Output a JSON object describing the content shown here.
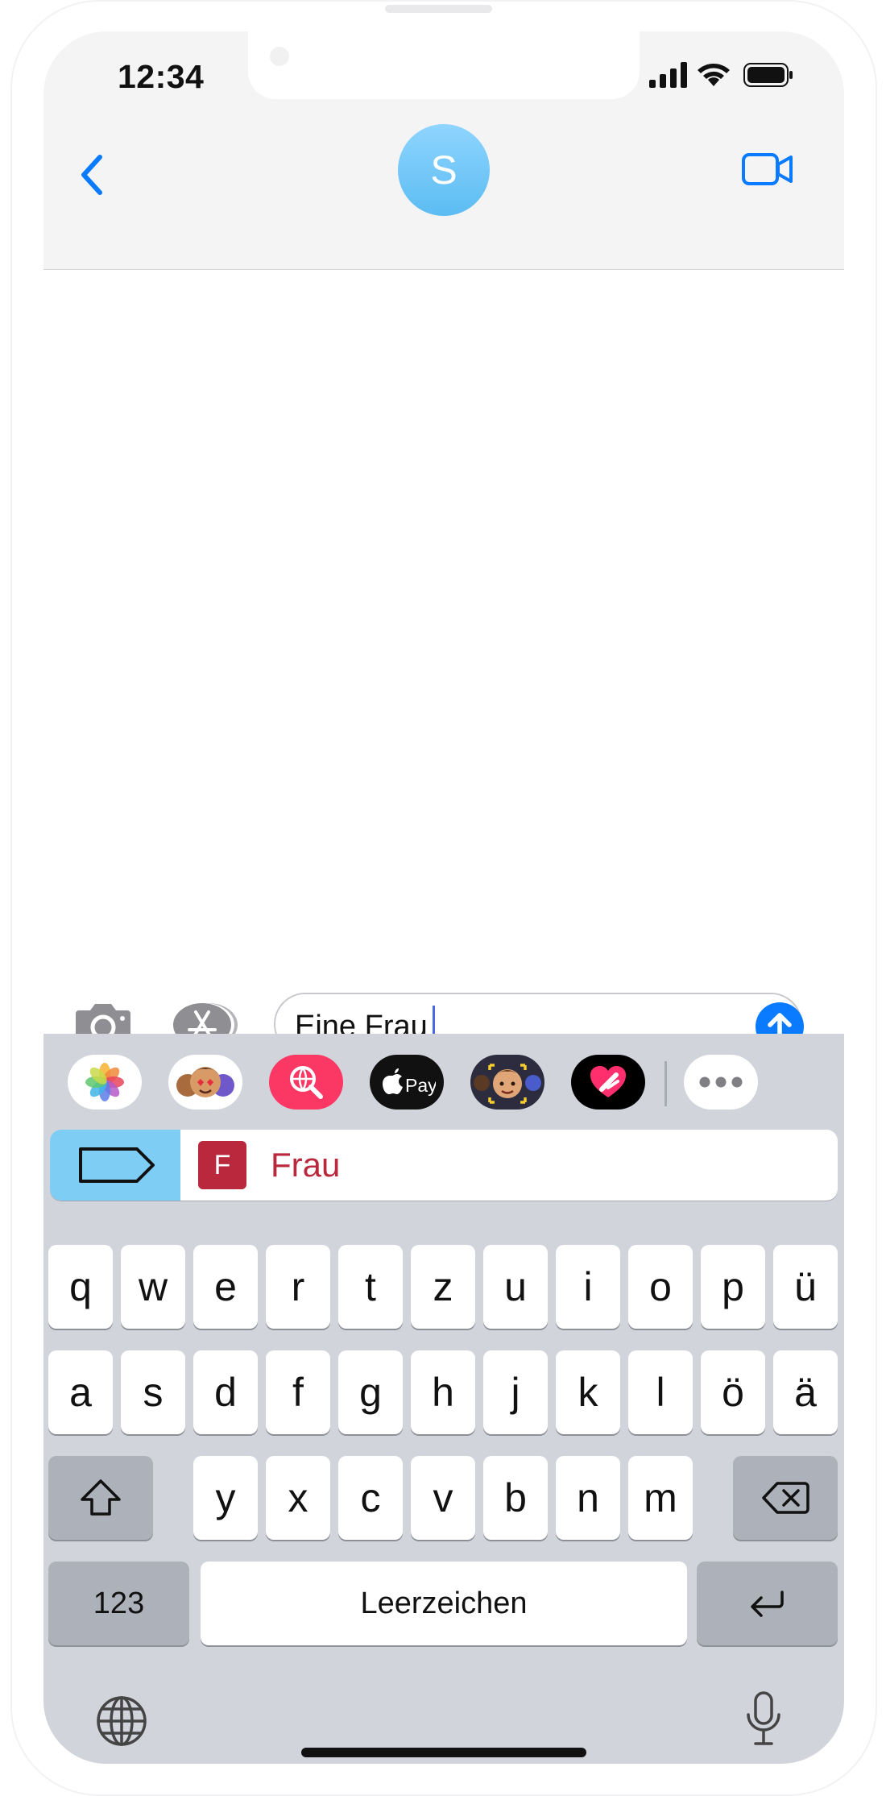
{
  "status_bar": {
    "time": "12:34"
  },
  "header": {
    "contact_initial": "S"
  },
  "compose": {
    "text": "Eine Frau"
  },
  "prediction": {
    "badge": "F",
    "word": "Frau"
  },
  "keyboard": {
    "row1": [
      "q",
      "w",
      "e",
      "r",
      "t",
      "z",
      "u",
      "i",
      "o",
      "p",
      "ü"
    ],
    "row2": [
      "a",
      "s",
      "d",
      "f",
      "g",
      "h",
      "j",
      "k",
      "l",
      "ö",
      "ä"
    ],
    "row3": [
      "y",
      "x",
      "c",
      "v",
      "b",
      "n",
      "m"
    ],
    "numbers_label": "123",
    "space_label": "Leerzeichen"
  },
  "colors": {
    "accent": "#0a7bff",
    "prediction_red": "#b9283c",
    "avatar_blue": "#6cc6f6",
    "keyboard_bg": "#d1d4db"
  },
  "icons": {
    "app_strip": [
      "photos-icon",
      "memoji-stickers-icon",
      "web-images-search-icon",
      "apple-pay-icon",
      "memoji-icon",
      "digital-touch-icon",
      "more-icon"
    ]
  }
}
